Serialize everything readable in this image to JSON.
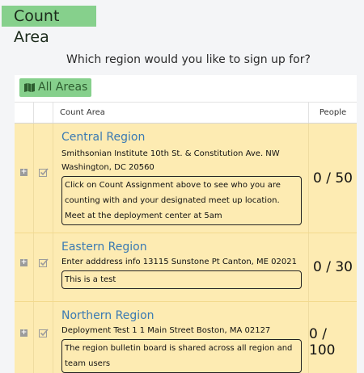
{
  "page": {
    "title": "Count Area"
  },
  "question": "Which region would you like to sign up for?",
  "toolbar": {
    "all_areas_label": "All Areas",
    "icon": "map-icon"
  },
  "table": {
    "headers": {
      "area": "Count Area",
      "people": "People"
    },
    "rows": [
      {
        "name": "Central Region",
        "address_lines": [
          "Smithsonian Institute 10th St. & Constitution Ave. NW",
          "Washington, DC 20560"
        ],
        "bulletin": "Click on Count Assignment above to see who you are counting with and your designated meet up location. Meet at the deployment center at 5am",
        "people": "0 / 50"
      },
      {
        "name": "Eastern Region",
        "address_lines": [
          "Enter adddress info 13115 Sunstone Pt Canton, ME 02021"
        ],
        "bulletin": "This is a test",
        "people": "0 / 30"
      },
      {
        "name": "Northern Region",
        "address_lines": [
          "Deployment Test 1 1 Main Street Boston, MA 02127"
        ],
        "bulletin": "The region bulletin board is shared across all region and team users",
        "people": "0 / 100"
      }
    ]
  },
  "colors": {
    "accent_green": "#86d08c",
    "row_background": "#fdebb2",
    "link_blue": "#3a7ab3"
  }
}
